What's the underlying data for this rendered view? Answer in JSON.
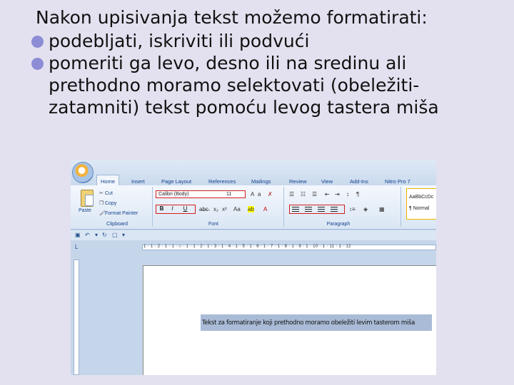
{
  "slide": {
    "heading": "Nakon upisivanja tekst možemo formatirati:",
    "bullets": [
      "podebljati, iskriviti ili podvući",
      "pomeriti ga levo, desno ili na sredinu ali\nprethodno moramo selektovati (obeležiti-\nzatamniti) tekst pomoću levog tastera miša"
    ]
  },
  "word": {
    "tabs": [
      "Home",
      "Insert",
      "Page Layout",
      "References",
      "Mailings",
      "Review",
      "View",
      "Add-Ins",
      "Nitro Pro 7"
    ],
    "clipboard": {
      "paste": "Paste",
      "cut": "Cut",
      "copy": "Copy",
      "format_painter": "Format Painter",
      "label": "Clipboard"
    },
    "font": {
      "name": "Calibri (Body)",
      "size": "11",
      "label": "Font",
      "bold": "B",
      "italic": "I",
      "underline": "U"
    },
    "paragraph": {
      "label": "Paragraph"
    },
    "styles": {
      "sample1": "AaBbCcDc",
      "sample2": "¶ Normal"
    },
    "ruler_numbers": "1 · 1 · 2 · 1 · 1 · ⌂ · 1 · 1 · 2 · 1 · 3 · 1 · 4 · 1 · 5 · 1 · 6 · 1 · 7 · 1 · 8 · 1 · 9 · 1 · 10 · 1 · 11 · 1 · 12",
    "document_text": "Tekst za formatiranje koji prethodno moramo obeležiti levim tasterom miša",
    "highlight_color": "#d21f1f"
  }
}
